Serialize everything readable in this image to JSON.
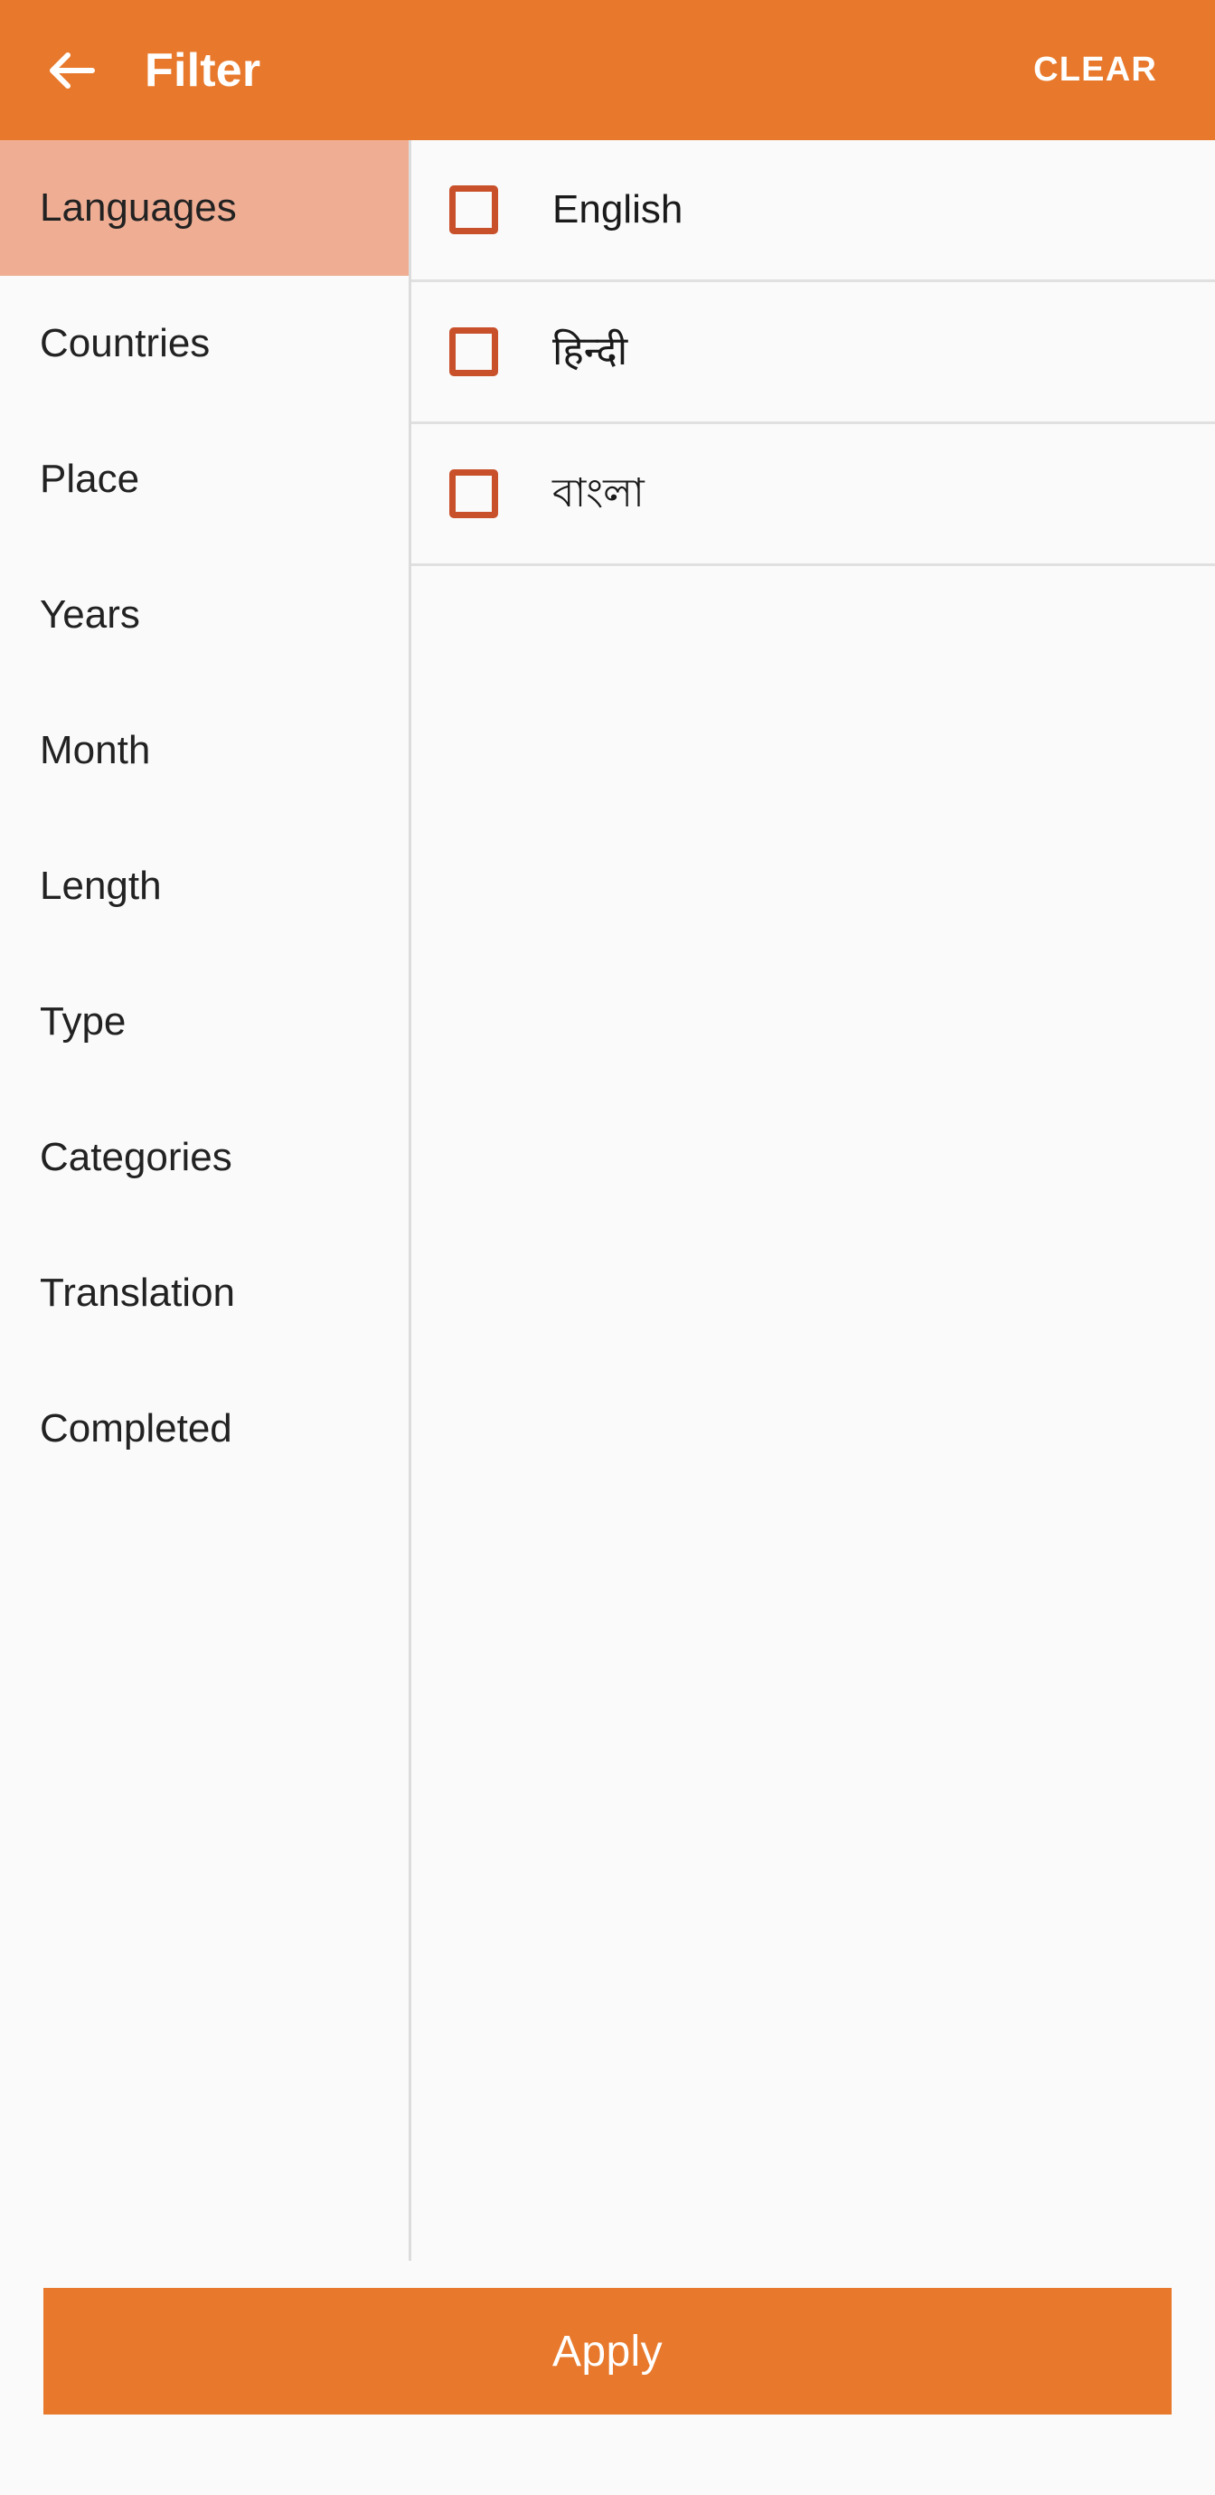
{
  "header": {
    "back_icon": "arrow-left-icon",
    "title": "Filter",
    "clear_label": "CLEAR",
    "bg_color": "#E8792C",
    "text_color": "#FFFFFF"
  },
  "sidebar": {
    "active_bg_color": "#EFAE94",
    "items": [
      {
        "label": "Languages",
        "active": true
      },
      {
        "label": "Countries",
        "active": false
      },
      {
        "label": "Place",
        "active": false
      },
      {
        "label": "Years",
        "active": false
      },
      {
        "label": "Month",
        "active": false
      },
      {
        "label": "Length",
        "active": false
      },
      {
        "label": "Type",
        "active": false
      },
      {
        "label": "Categories",
        "active": false
      },
      {
        "label": "Translation",
        "active": false
      },
      {
        "label": "Completed",
        "active": false
      }
    ]
  },
  "options": {
    "checkbox_color": "#C8502A",
    "items": [
      {
        "label": "English",
        "checked": false
      },
      {
        "label": "हिन्दी",
        "checked": false
      },
      {
        "label": "বাংলা",
        "checked": false
      }
    ]
  },
  "footer": {
    "apply_label": "Apply",
    "apply_bg_color": "#E8792C"
  }
}
